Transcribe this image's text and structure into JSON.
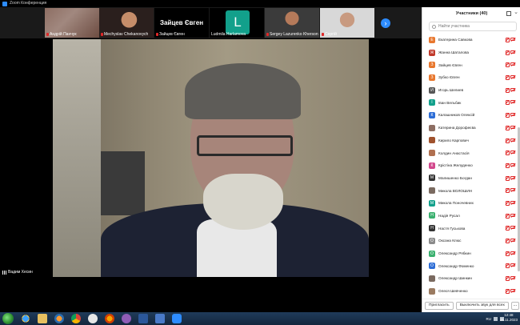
{
  "window": {
    "title": "Zoom Конференция"
  },
  "thumbnails": [
    {
      "name": "Андрій Панчук"
    },
    {
      "name": "Mechyslav Chekanovych"
    },
    {
      "name": "Зайцев Євген",
      "big_label": "Зайцев Євген"
    },
    {
      "name": "Ludmila Harlamova",
      "letter": "L"
    },
    {
      "name": "Sergey Lazurenko Kherson"
    },
    {
      "name": "Сергій"
    }
  ],
  "next_arrow": "›",
  "main_speaker": {
    "name": "Вадим Хесин"
  },
  "panel": {
    "title": "Участники (40)",
    "close_glyph": "⌄",
    "search_placeholder": "Найти участника",
    "participants": [
      {
        "initial": "Е",
        "name": "Екатерина Савкова",
        "color": "#e8772e"
      },
      {
        "initial": "Ж",
        "name": "Жанна Шаталова",
        "color": "#c0392b"
      },
      {
        "initial": "З",
        "name": "Зайцев Євген",
        "color": "#e8772e"
      },
      {
        "initial": "З",
        "name": "Зубко Євген",
        "color": "#e8772e"
      },
      {
        "initial": "И",
        "name": "Игорь Шелиев",
        "color": "#555555"
      },
      {
        "initial": "І",
        "name": "Іван Вельбик",
        "color": "#12a08b"
      },
      {
        "initial": "К",
        "name": "Калашников Олексій",
        "color": "#2d6dd6"
      },
      {
        "initial": "",
        "name": "Катерина Дорофеєва",
        "color": "#8d6e63"
      },
      {
        "initial": "",
        "name": "Кирило Карпович",
        "color": "#a0522d"
      },
      {
        "initial": "",
        "name": "Колдин Анастасія",
        "color": "#b07050"
      },
      {
        "initial": "К",
        "name": "Крістіна Желуденко",
        "color": "#d2478c"
      },
      {
        "initial": "М",
        "name": "Малишенко Богдан",
        "color": "#333333"
      },
      {
        "initial": "",
        "name": "Микола ВОЛОШИН",
        "color": "#7a6a60"
      },
      {
        "initial": "М",
        "name": "Микола Поночевних",
        "color": "#12a08b"
      },
      {
        "initial": "Н",
        "name": "Надія Русал",
        "color": "#3ab06e"
      },
      {
        "initial": "Н",
        "name": "Настя Гуськова",
        "color": "#333333"
      },
      {
        "initial": "О",
        "name": "Оксана Клюс",
        "color": "#8a8a8a"
      },
      {
        "initial": "О",
        "name": "Олександр Рябкин",
        "color": "#3ab06e"
      },
      {
        "initial": "О",
        "name": "Олександр Фоменко",
        "color": "#2d6dd6"
      },
      {
        "initial": "",
        "name": "Олександр Шинкин",
        "color": "#7a6a60"
      },
      {
        "initial": "",
        "name": "Олеся Шевченко",
        "color": "#9a7a60"
      }
    ],
    "footer": {
      "invite": "Пригласить",
      "mute_all": "Выключить звук для всех",
      "more": "..."
    }
  },
  "taskbar": {
    "lang": "RU",
    "time": "12:48",
    "date": "15.11.2023"
  },
  "colors": {
    "zoom_blue": "#2d8cff",
    "muted_red": "#e02828"
  }
}
